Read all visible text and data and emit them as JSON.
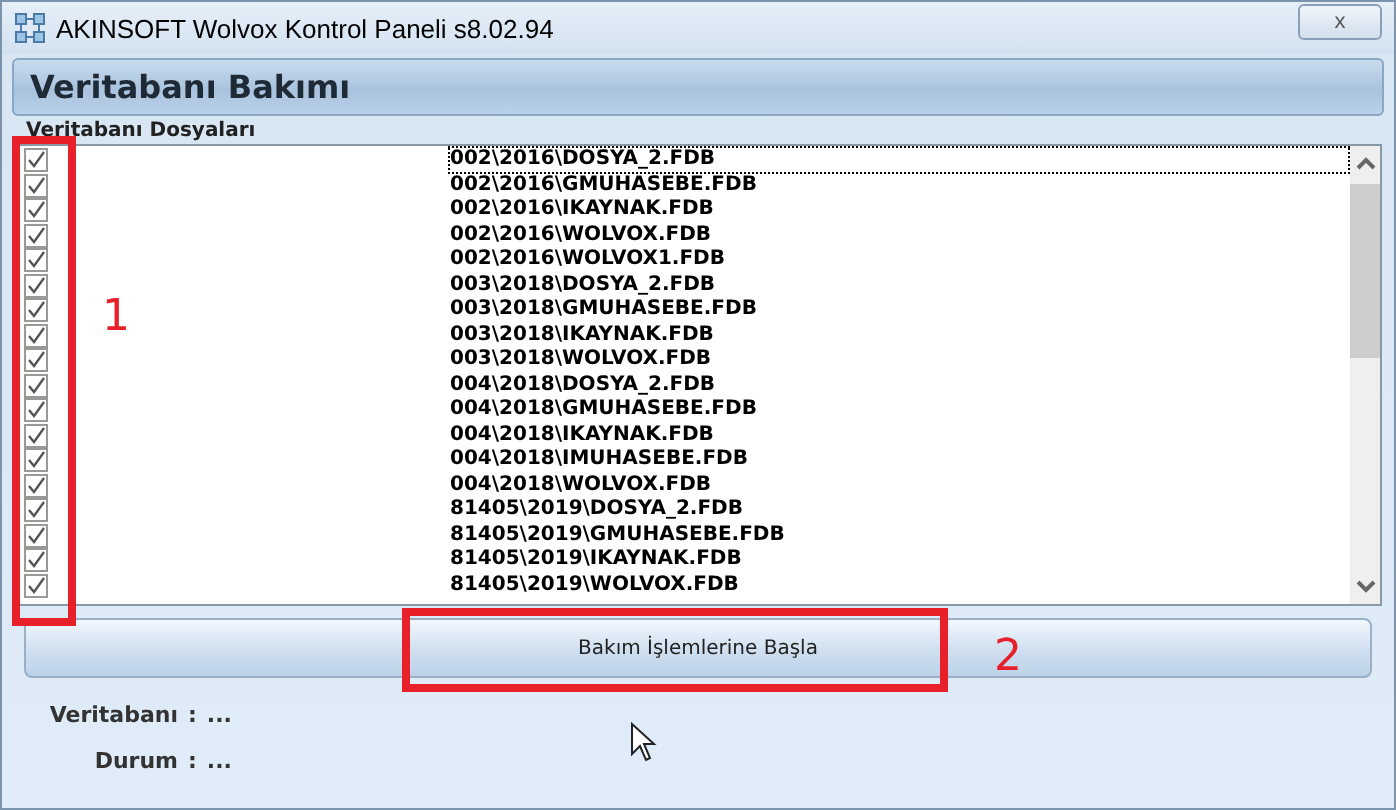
{
  "window": {
    "title": "AKINSOFT Wolvox Kontrol Paneli s8.02.94",
    "close": "x"
  },
  "header": {
    "title": "Veritabanı Bakımı"
  },
  "files": {
    "label": "Veritabanı Dosyaları",
    "rows": [
      {
        "path": "002\\2016\\DOSYA_2.FDB",
        "checked": true,
        "selected": true
      },
      {
        "path": "002\\2016\\GMUHASEBE.FDB",
        "checked": true,
        "selected": false
      },
      {
        "path": "002\\2016\\IKAYNAK.FDB",
        "checked": true,
        "selected": false
      },
      {
        "path": "002\\2016\\WOLVOX.FDB",
        "checked": true,
        "selected": false
      },
      {
        "path": "002\\2016\\WOLVOX1.FDB",
        "checked": true,
        "selected": false
      },
      {
        "path": "003\\2018\\DOSYA_2.FDB",
        "checked": true,
        "selected": false
      },
      {
        "path": "003\\2018\\GMUHASEBE.FDB",
        "checked": true,
        "selected": false
      },
      {
        "path": "003\\2018\\IKAYNAK.FDB",
        "checked": true,
        "selected": false
      },
      {
        "path": "003\\2018\\WOLVOX.FDB",
        "checked": true,
        "selected": false
      },
      {
        "path": "004\\2018\\DOSYA_2.FDB",
        "checked": true,
        "selected": false
      },
      {
        "path": "004\\2018\\GMUHASEBE.FDB",
        "checked": true,
        "selected": false
      },
      {
        "path": "004\\2018\\IKAYNAK.FDB",
        "checked": true,
        "selected": false
      },
      {
        "path": "004\\2018\\IMUHASEBE.FDB",
        "checked": true,
        "selected": false
      },
      {
        "path": "004\\2018\\WOLVOX.FDB",
        "checked": true,
        "selected": false
      },
      {
        "path": "81405\\2019\\DOSYA_2.FDB",
        "checked": true,
        "selected": false
      },
      {
        "path": "81405\\2019\\GMUHASEBE.FDB",
        "checked": true,
        "selected": false
      },
      {
        "path": "81405\\2019\\IKAYNAK.FDB",
        "checked": true,
        "selected": false
      },
      {
        "path": "81405\\2019\\WOLVOX.FDB",
        "checked": true,
        "selected": false
      }
    ]
  },
  "start_button": "Bakım İşlemlerine Başla",
  "info": [
    {
      "label": "Veritabanı",
      "separator": ":",
      "value": "..."
    },
    {
      "label": "Durum",
      "separator": ":",
      "value": "..."
    }
  ],
  "annotations": [
    {
      "label": "1"
    },
    {
      "label": "2"
    }
  ]
}
